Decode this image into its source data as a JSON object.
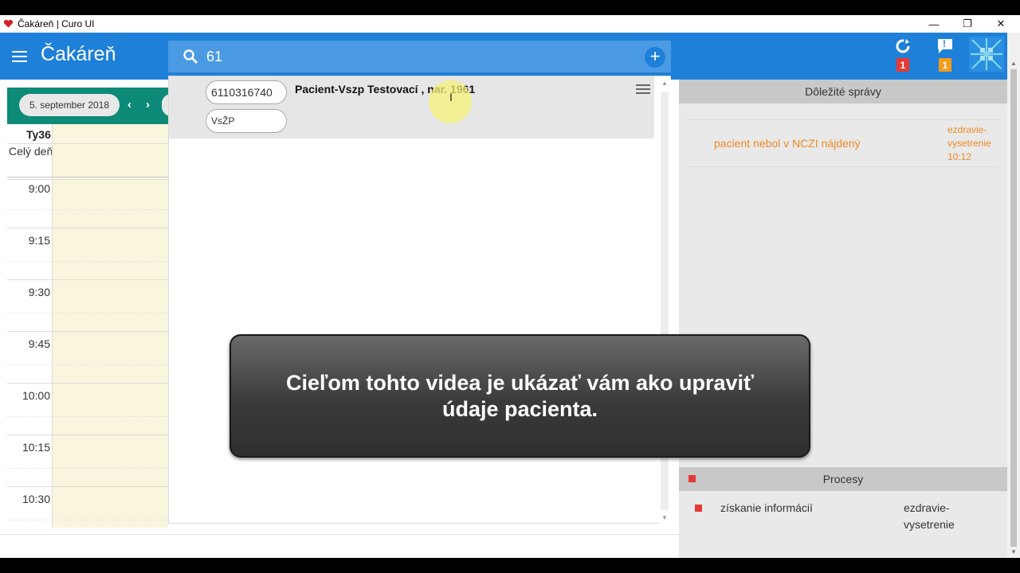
{
  "window": {
    "title": "Čakáreň | Curo UI",
    "minimize": "—",
    "restore": "❐",
    "close": "✕"
  },
  "header": {
    "title": "Čakáreň",
    "sync_badge": "1",
    "alert_icon_glyph": "!",
    "alert_badge": "1",
    "badge_colors": {
      "sync": "#e53935",
      "alert": "#f59c1a"
    }
  },
  "search": {
    "value": "61",
    "add_label": "+"
  },
  "results": [
    {
      "id_number": "6110316740",
      "insurer": "VsŽP",
      "name": "Pacient-Vszp Testovací , nar. 1961"
    }
  ],
  "calendar": {
    "date": "5. september 2018",
    "prev": "‹",
    "next": "›",
    "week": "Ty36",
    "all_day": "Celý deň",
    "times": [
      "9:00",
      "9:15",
      "9:30",
      "9:45",
      "10:00",
      "10:15",
      "10:30"
    ]
  },
  "important_messages": {
    "title": "Dôležité správy",
    "items": [
      {
        "text": "pacient nebol v NCZI nájdený",
        "source_1": "ezdravie-",
        "source_2": "vysetrenie",
        "time": "10:12"
      }
    ]
  },
  "processes": {
    "title": "Procesy",
    "items": [
      {
        "name": "získanie informácií",
        "source_1": "ezdravie-",
        "source_2": "vysetrenie"
      }
    ]
  },
  "caption": {
    "text": "Cieľom tohto videa je ukázať vám ako upraviť údaje pacienta."
  },
  "colors": {
    "accent": "#1e80d8",
    "calendar_header": "#0e8a78",
    "message": "#f08a24",
    "process_marker": "#e53935"
  }
}
